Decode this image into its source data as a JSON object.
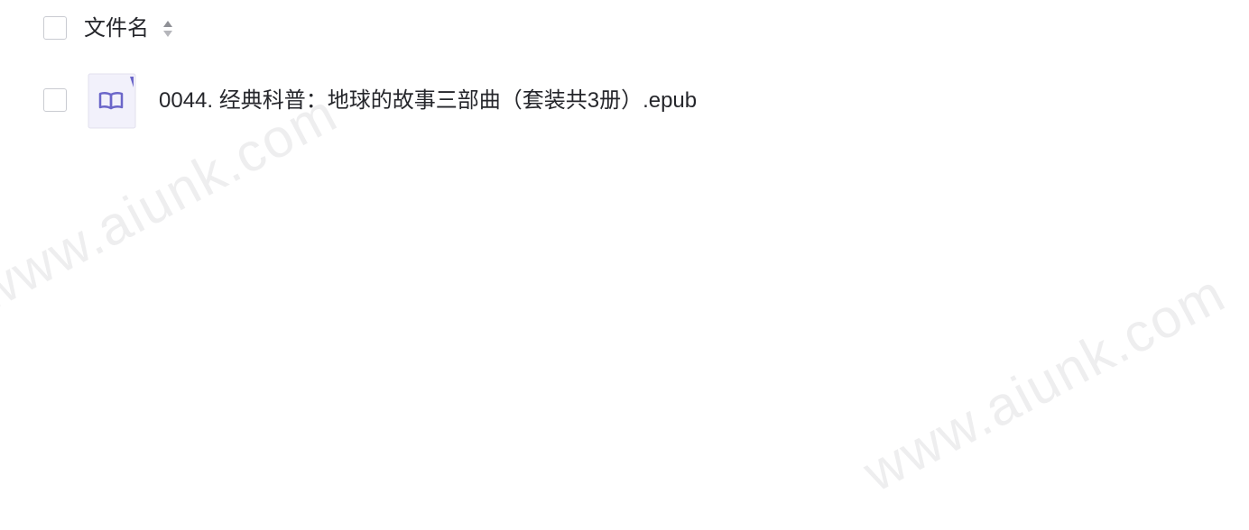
{
  "header": {
    "column_title": "文件名",
    "sort_icon": "sort-updown-icon"
  },
  "files": [
    {
      "name": "0044. 经典科普：地球的故事三部曲（套装共3册）.epub",
      "icon": "epub-book-icon",
      "checked": false
    }
  ],
  "watermarks": [
    "www.aiunk.com",
    "www.aiunk.com"
  ],
  "colors": {
    "text": "#25262b",
    "checkbox_border": "#c9cbd1",
    "icon_accent": "#6b66c9",
    "icon_bg": "#f2f1fb",
    "watermark": "#eeeeef"
  }
}
